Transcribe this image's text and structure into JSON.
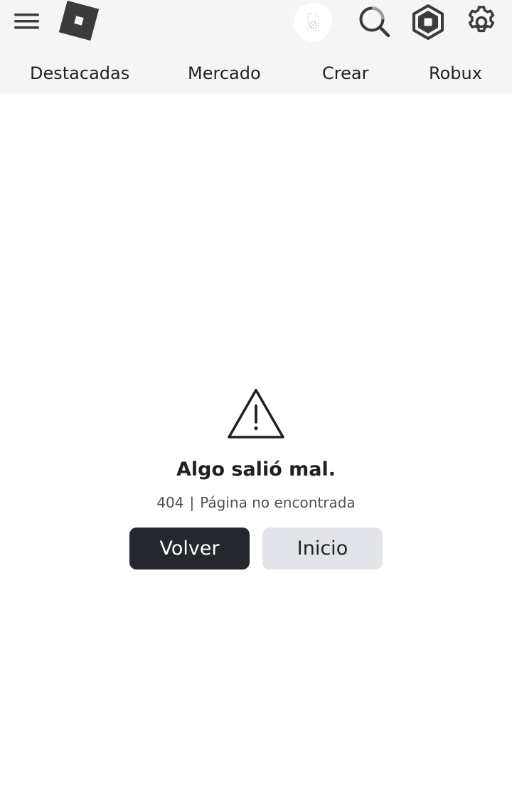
{
  "header": {
    "icons": {
      "menu": "hamburger-menu-icon",
      "logo": "roblox-logo",
      "avatar": "avatar-placeholder-icon",
      "search": "search-icon",
      "robux": "robux-icon",
      "settings": "gear-icon"
    },
    "nav": [
      {
        "label": "Destacadas"
      },
      {
        "label": "Mercado"
      },
      {
        "label": "Crear"
      },
      {
        "label": "Robux"
      }
    ]
  },
  "error": {
    "icon": "warning-triangle-icon",
    "title": "Algo salió mal.",
    "code": "404",
    "separator": "|",
    "message": "Página no encontrada",
    "back_label": "Volver",
    "home_label": "Inicio"
  },
  "colors": {
    "header_bg": "#f5f5f6",
    "icon_dark": "#393b3d",
    "primary_button": "#24272e",
    "secondary_button": "#e3e4e9",
    "text": "#1e2024"
  }
}
